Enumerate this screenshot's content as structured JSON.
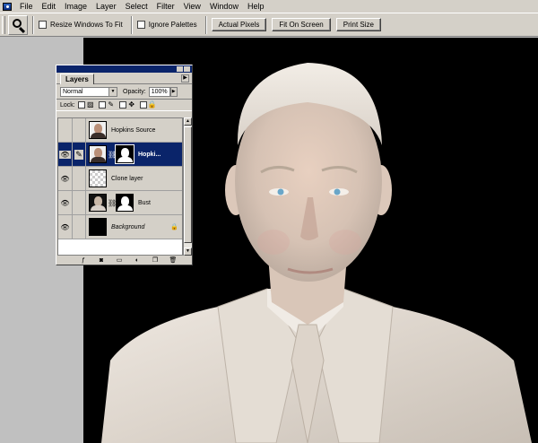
{
  "menu": {
    "items": [
      "File",
      "Edit",
      "Image",
      "Layer",
      "Select",
      "Filter",
      "View",
      "Window",
      "Help"
    ]
  },
  "options_bar": {
    "resize_windows_label": "Resize Windows To Fit",
    "ignore_palettes_label": "Ignore Palettes",
    "actual_pixels": "Actual Pixels",
    "fit_on_screen": "Fit On Screen",
    "print_size": "Print Size"
  },
  "layers_palette": {
    "tab": "Layers",
    "menu_arrow": "▶",
    "blend_mode": "Normal",
    "opacity_label": "Opacity:",
    "opacity_value": "100%",
    "lock_label": "Lock:",
    "layers": [
      {
        "name": "Hopkins Source"
      },
      {
        "name": "Hopki..."
      },
      {
        "name": "Clone layer"
      },
      {
        "name": "Bust"
      },
      {
        "name": "Background"
      }
    ]
  },
  "colors": {
    "title_bar": "#0a246a",
    "chrome": "#d4d0c8",
    "workspace": "#c0c0c0",
    "canvas": "#000000"
  }
}
